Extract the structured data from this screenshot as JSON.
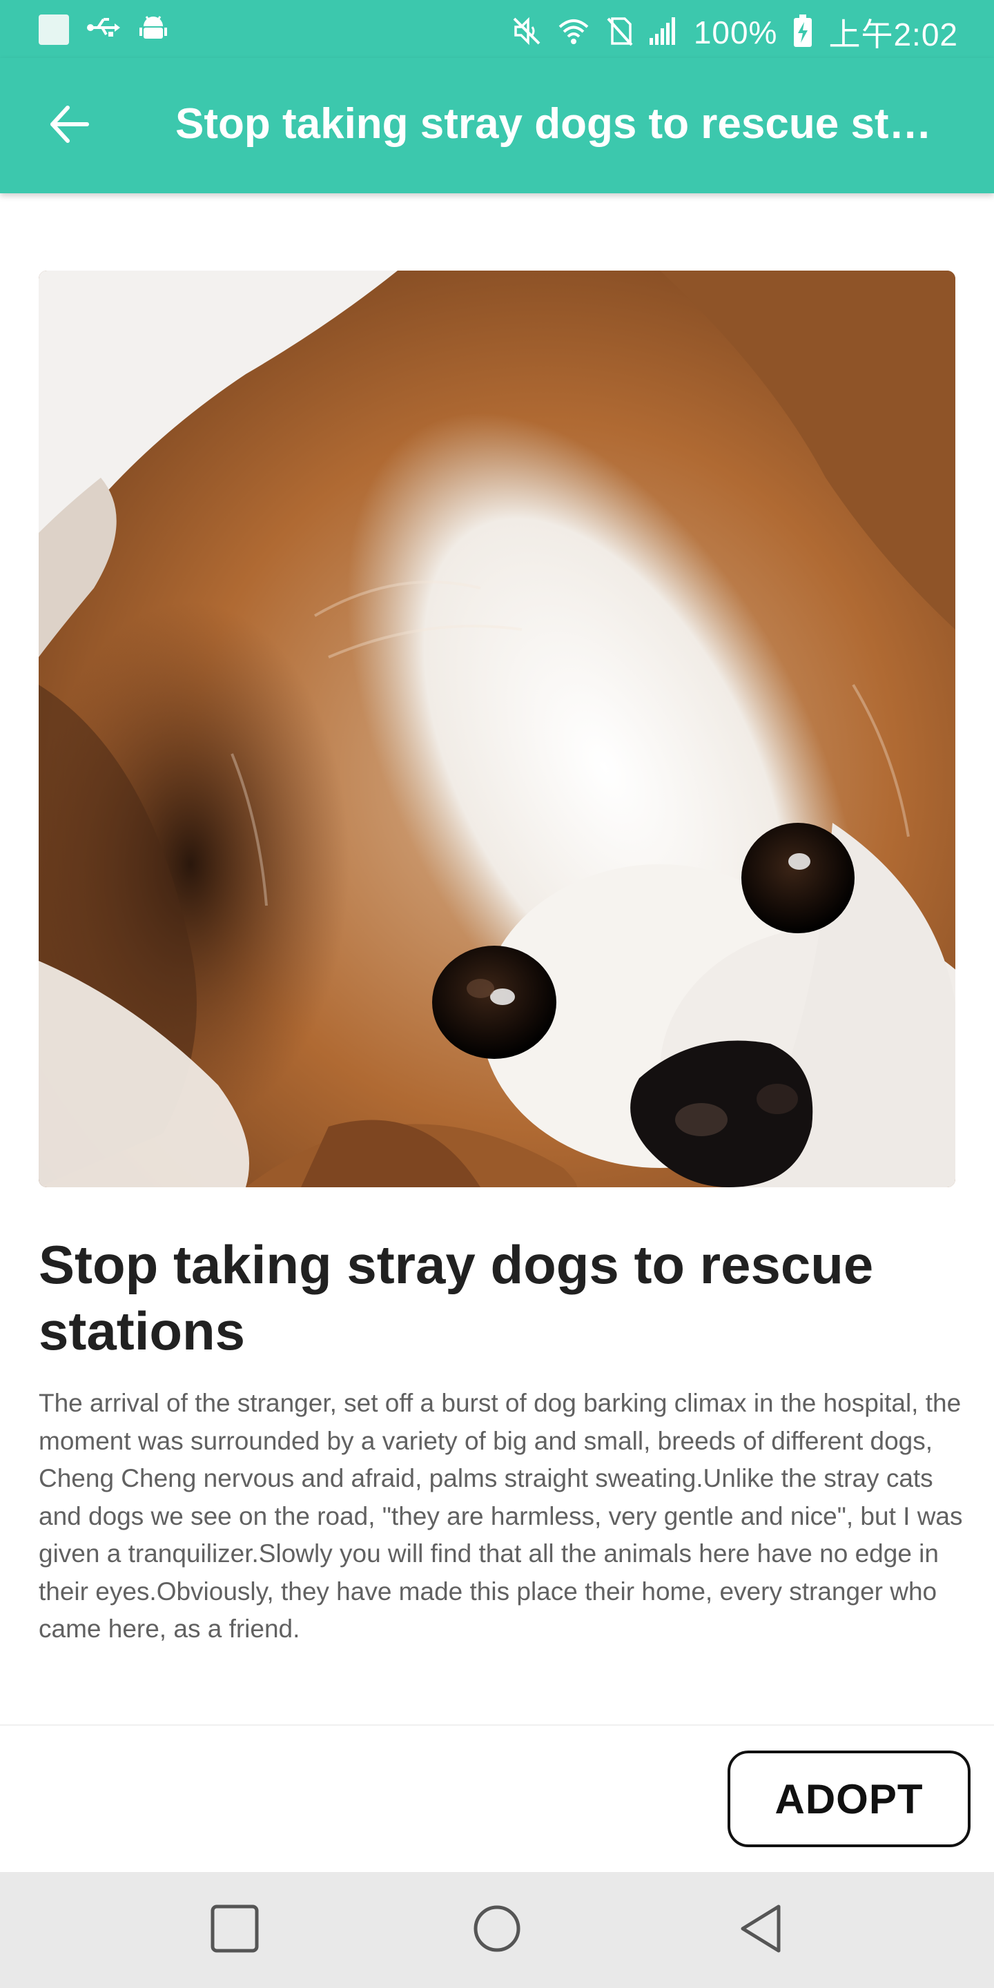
{
  "status_bar": {
    "battery_text": "100%",
    "time": "上午2:02",
    "icons": [
      "notification-square-icon",
      "usb-icon",
      "android-debug-icon",
      "mute-icon",
      "wifi-icon",
      "no-sim-icon",
      "signal-icon",
      "battery-charging-icon"
    ]
  },
  "app_bar": {
    "title": "Stop taking stray dogs to rescue stations",
    "back_icon": "arrow-left-icon"
  },
  "article": {
    "image": "dog-photo",
    "title": "Stop taking stray dogs to rescue stations",
    "body": "The arrival of the stranger, set off a burst of dog barking climax in the hospital, the moment was surrounded by a variety of big and small, breeds of different dogs, Cheng Cheng nervous and afraid, palms straight sweating.Unlike the stray cats and dogs we see on the road, \"they are harmless, very gentle and nice\", but I was given a tranquilizer.Slowly you will find that all the animals here have no edge in their eyes.Obviously, they have made this place their home, every stranger who came here, as a friend."
  },
  "actions": {
    "adopt_label": "ADOPT"
  },
  "nav_bar": {
    "icons": [
      "recent-apps-icon",
      "home-icon",
      "back-triangle-icon"
    ]
  },
  "colors": {
    "accent": "#3cc8ad",
    "title_text": "#212121",
    "body_text": "#616161",
    "nav_background": "#e9e9e9"
  }
}
